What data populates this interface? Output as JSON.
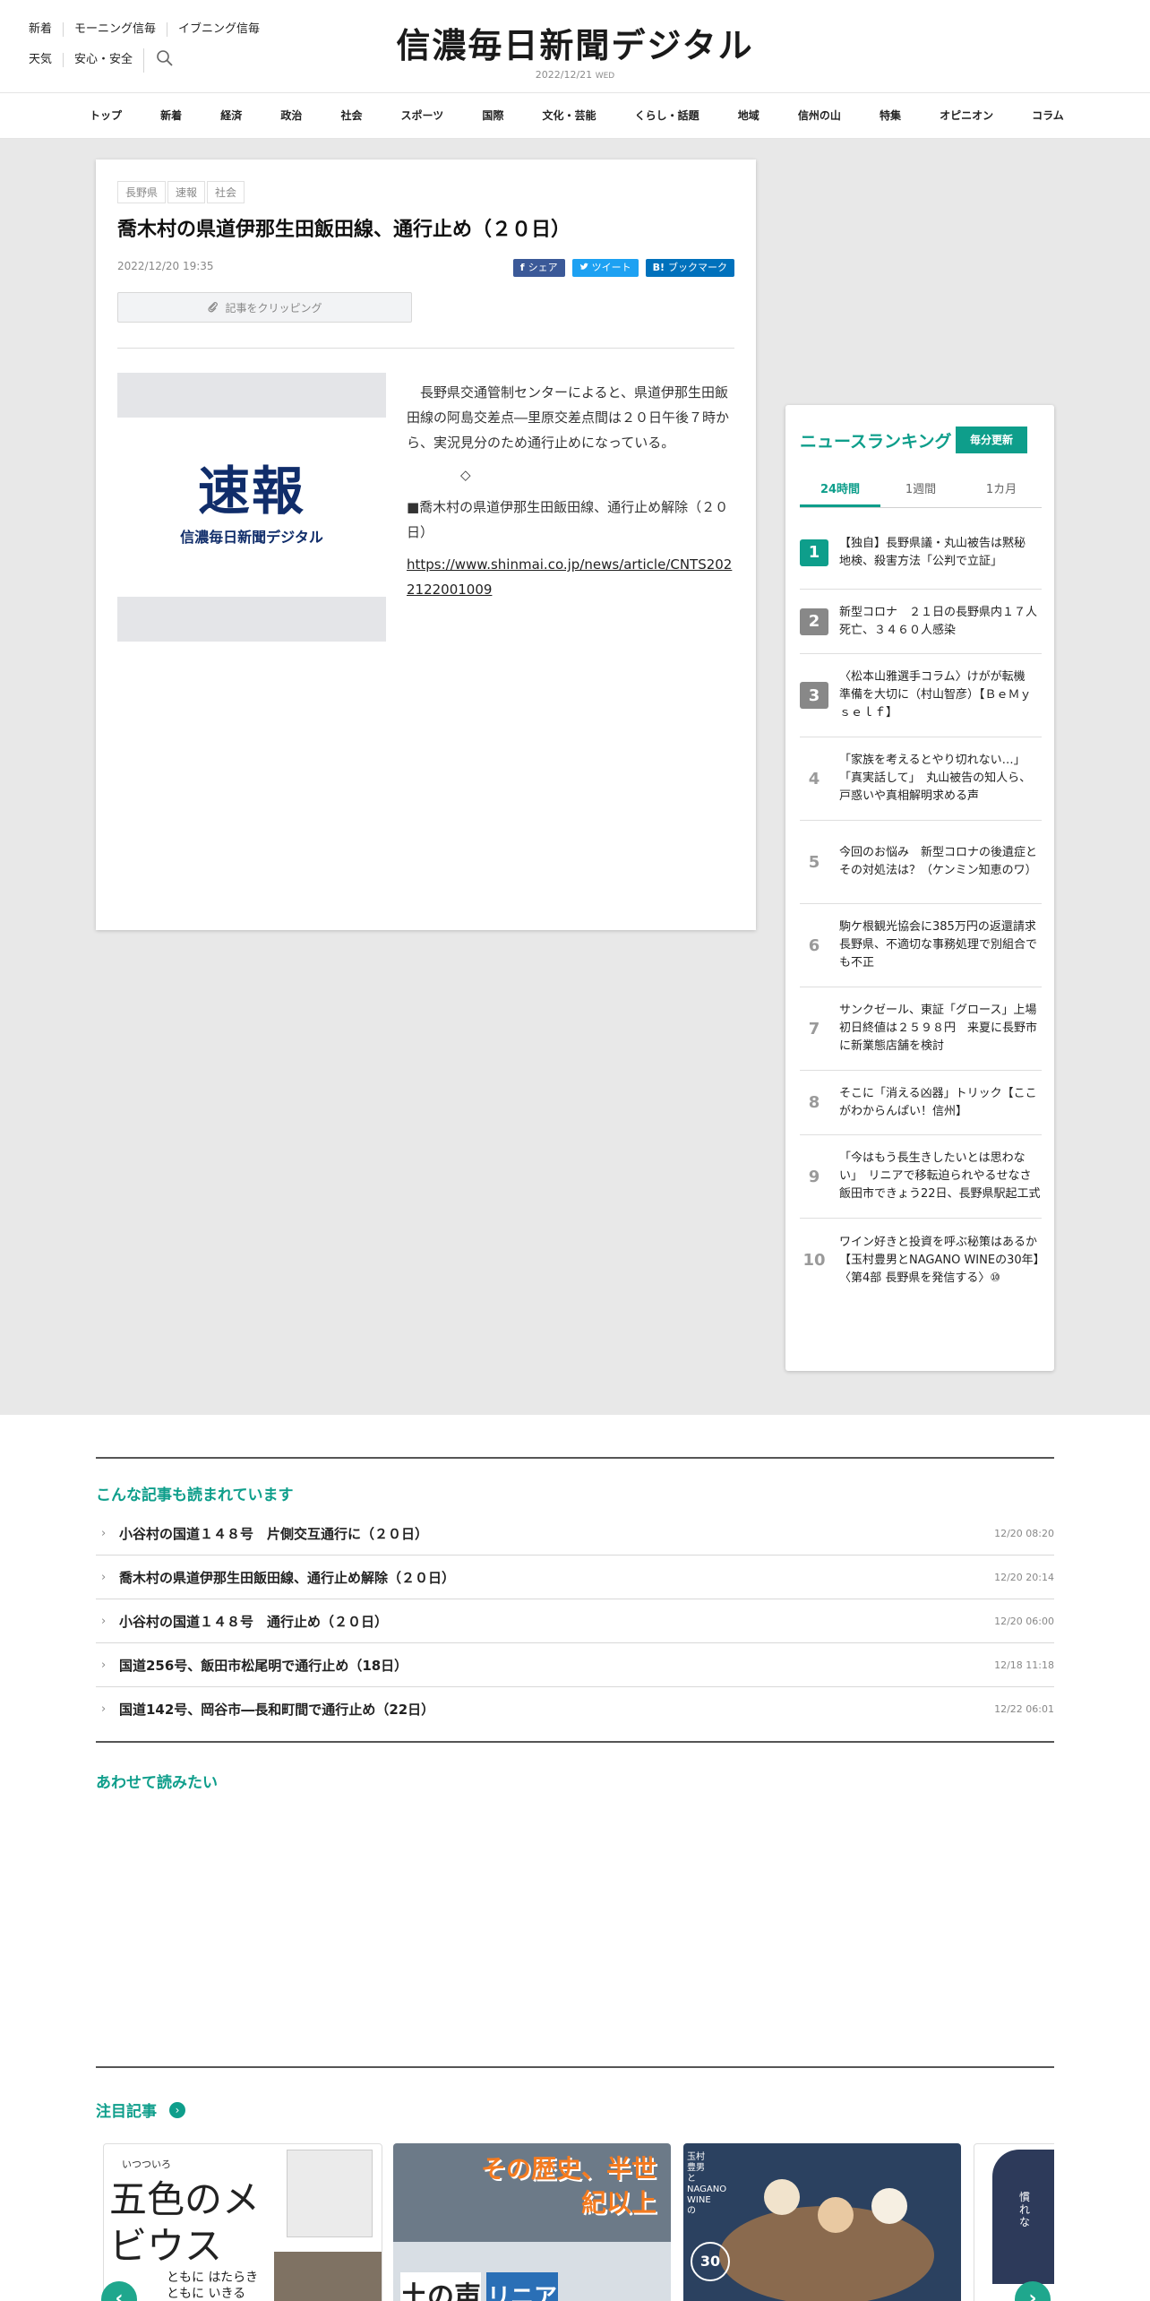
{
  "header": {
    "utility_row1": [
      "新着",
      "モーニング信毎",
      "イブニング信毎"
    ],
    "utility_row2": [
      "天気",
      "安心・安全"
    ],
    "logo": "信濃毎日新聞デジタル",
    "date": "2022/12/21",
    "weekday": "WED"
  },
  "nav": [
    "トップ",
    "新着",
    "経済",
    "政治",
    "社会",
    "スポーツ",
    "国際",
    "文化・芸能",
    "くらし・話題",
    "地域",
    "信州の山",
    "特集",
    "オピニオン",
    "コラム"
  ],
  "article": {
    "tags": [
      "長野県",
      "速報",
      "社会"
    ],
    "title": "喬木村の県道伊那生田飯田線、通行止め（２０日）",
    "datetime": "2022/12/20 19:35",
    "share": {
      "facebook": "シェア",
      "twitter": "ツイート",
      "hatena": "ブックマーク",
      "hatena_prefix": "B!"
    },
    "clip_label": "記事をクリッピング",
    "image": {
      "main": "速報",
      "sub": "信濃毎日新聞デジタル"
    },
    "body": [
      "長野県交通管制センターによると、県道伊那生田飯田線の阿島交差点―里原交差点間は２０日午後７時から、実況見分のため通行止めになっている。",
      "◇",
      "■喬木村の県道伊那生田飯田線、通行止め解除（２０日）"
    ],
    "link": "https://www.shinmai.co.jp/news/article/CNTS2022122001009"
  },
  "ranking": {
    "title": "ニュースランキング",
    "badge": "毎分更新",
    "tabs": [
      "24時間",
      "1週間",
      "1カ月"
    ],
    "active_tab": "24時間",
    "items": [
      {
        "rank": "1",
        "text": "【独自】長野県議・丸山被告は黙秘　地検、殺害方法「公判で立証」"
      },
      {
        "rank": "2",
        "text": "新型コロナ　２１日の長野県内１７人死亡、３４６０人感染"
      },
      {
        "rank": "3",
        "text": "〈松本山雅選手コラム〉けがが転機　準備を大切に（村山智彦）【ＢｅＭｙｓｅｌｆ】"
      },
      {
        "rank": "4",
        "text": "「家族を考えるとやり切れない…」「真実話して」　丸山被告の知人ら、戸惑いや真相解明求める声"
      },
      {
        "rank": "5",
        "text": "今回のお悩み　新型コロナの後遺症とその対処法は？（ケンミン知恵のワ）"
      },
      {
        "rank": "6",
        "text": "駒ケ根観光協会に385万円の返還請求　長野県、不適切な事務処理で別組合でも不正"
      },
      {
        "rank": "7",
        "text": "サンクゼール、東証「グロース」上場　初日終値は２５９８円　来夏に長野市に新業態店舗を検討"
      },
      {
        "rank": "8",
        "text": "そこに「消える凶器」トリック【ここがわからんぱい！信州】"
      },
      {
        "rank": "9",
        "text": "「今はもう長生きしたいとは思わない」　リニアで移転迫られやるせなさ　飯田市できょう22日、長野県駅起工式"
      },
      {
        "rank": "10",
        "text": "ワイン好きと投資を呼ぶ秘策はあるか【玉村豊男とNAGANO WINEの30年】〈第4部 長野県を発信する〉⑩"
      }
    ]
  },
  "related": {
    "title": "こんな記事も読まれています",
    "items": [
      {
        "title": "小谷村の国道１４８号　片側交互通行に（２０日）",
        "date": "12/20 08:20"
      },
      {
        "title": "喬木村の県道伊那生田飯田線、通行止め解除（２０日）",
        "date": "12/20 20:14"
      },
      {
        "title": "小谷村の国道１４８号　通行止め（２０日）",
        "date": "12/20 06:00"
      },
      {
        "title": "国道256号、飯田市松尾明で通行止め（18日）",
        "date": "12/18 11:18"
      },
      {
        "title": "国道142号、岡谷市―長和町間で通行止め（22日）",
        "date": "12/22 06:01"
      }
    ]
  },
  "also_read": {
    "title": "あわせて読みたい"
  },
  "featured": {
    "title": "注目記事",
    "cards": [
      {
        "small": "いつついろ",
        "title": "五色のメビウス",
        "sub": "ともに はたらき ともに いきる"
      },
      {
        "title": "その歴史、半世紀以上",
        "sign1": "土の声",
        "sign2": "リニア"
      },
      {
        "label": "玉村豊男とNAGANO WINEの",
        "badge": "30"
      },
      {
        "text": "慣れな"
      }
    ]
  },
  "colors": {
    "accent": "#0e9e8b",
    "facebook": "#3b5998",
    "twitter": "#1da1f2",
    "hatena": "#0071bc",
    "logo_navy": "#102d6a"
  }
}
